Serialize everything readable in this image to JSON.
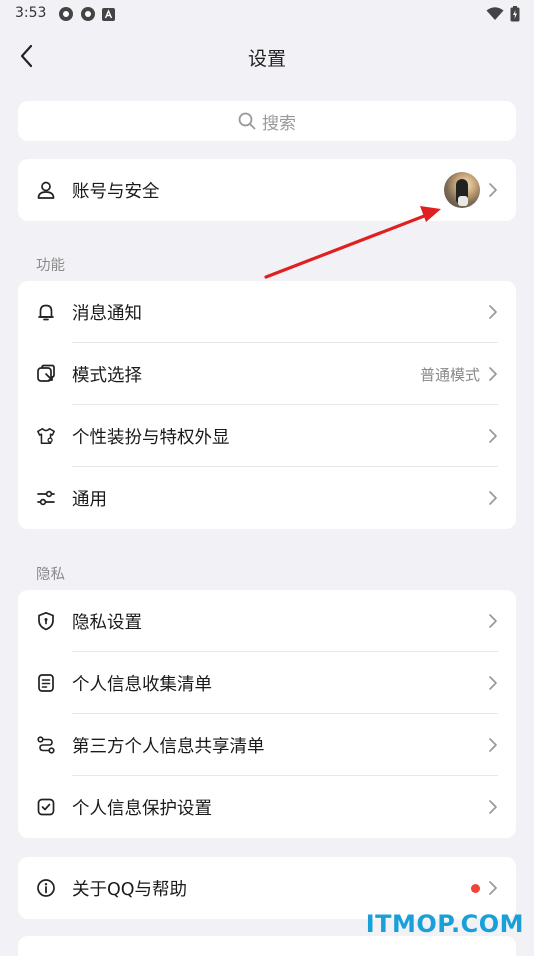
{
  "status_bar": {
    "time": "3:53"
  },
  "nav": {
    "title": "设置"
  },
  "search": {
    "placeholder": "搜索"
  },
  "account": {
    "label": "账号与安全"
  },
  "sections": {
    "features": {
      "title": "功能",
      "items": [
        {
          "label": "消息通知",
          "value": ""
        },
        {
          "label": "模式选择",
          "value": "普通模式"
        },
        {
          "label": "个性装扮与特权外显",
          "value": ""
        },
        {
          "label": "通用",
          "value": ""
        }
      ]
    },
    "privacy": {
      "title": "隐私",
      "items": [
        {
          "label": "隐私设置"
        },
        {
          "label": "个人信息收集清单"
        },
        {
          "label": "第三方个人信息共享清单"
        },
        {
          "label": "个人信息保护设置"
        }
      ]
    }
  },
  "about": {
    "label": "关于QQ与帮助"
  },
  "watermark": "ITMOP.COM",
  "colors": {
    "background": "#f2f2f6",
    "card": "#ffffff",
    "arrow": "#e02020",
    "badge": "#f04438",
    "watermark": "#1aa0d8"
  },
  "icons": {
    "account": "person-icon",
    "notify": "bell-icon",
    "mode": "mode-select-icon",
    "theme": "shirt-icon",
    "general": "sliders-icon",
    "privacy": "shield-icon",
    "collect": "document-list-icon",
    "share": "share-flow-icon",
    "protect": "checkbox-icon",
    "about": "info-icon"
  }
}
